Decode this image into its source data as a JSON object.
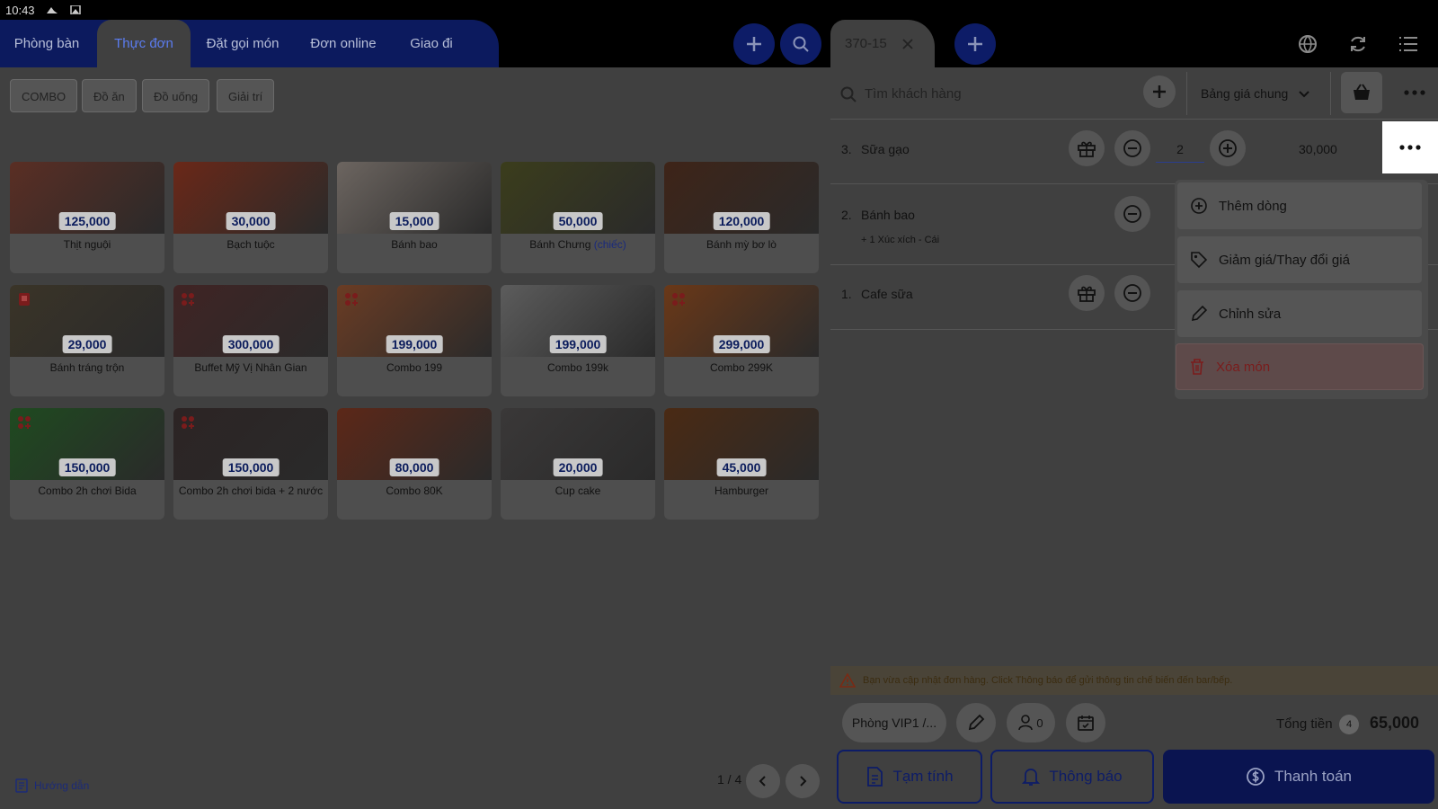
{
  "status": {
    "time": "10:43"
  },
  "nav": {
    "tabs": [
      {
        "label": "Phòng bàn"
      },
      {
        "label": "Thực đơn"
      },
      {
        "label": "Đặt gọi món"
      },
      {
        "label": "Đơn online"
      },
      {
        "label": "Giao đi"
      }
    ]
  },
  "filters": [
    "COMBO",
    "Đồ ăn",
    "Đồ uống",
    "Giải trí"
  ],
  "products": [
    {
      "price": "125,000",
      "name": "Thịt nguội",
      "color": "#5a2e24"
    },
    {
      "price": "30,000",
      "name": "Bạch tuộc",
      "color": "#6a2818"
    },
    {
      "price": "15,000",
      "name": "Bánh bao",
      "color": "#6c6560"
    },
    {
      "price": "50,000",
      "name": "Bánh Chưng",
      "name_hl": "(chiếc)",
      "color": "#3b3d1c"
    },
    {
      "price": "120,000",
      "name": "Bánh mỳ bơ lò",
      "color": "#3e2418"
    },
    {
      "price": "29,000",
      "name": "Bánh tráng trộn",
      "color": "#3a3428"
    },
    {
      "price": "300,000",
      "name": "Buffet Mỹ Vị Nhân Gian",
      "color": "#402424"
    },
    {
      "price": "199,000",
      "name": "Combo 199",
      "color": "#6a3c24"
    },
    {
      "price": "199,000",
      "name": "Combo 199k",
      "color": "#5c5c5c"
    },
    {
      "price": "299,000",
      "name": "Combo 299K",
      "color": "#6a3818"
    },
    {
      "price": "150,000",
      "name": "Combo 2h chơi Bida",
      "color": "#1f4a20"
    },
    {
      "price": "150,000",
      "name": "Combo 2h chơi bida + 2 nước",
      "color": "#2c2424"
    },
    {
      "price": "80,000",
      "name": "Combo 80K",
      "color": "#5c2818"
    },
    {
      "price": "20,000",
      "name": "Cup cake",
      "color": "#3a3838"
    },
    {
      "price": "45,000",
      "name": "Hamburger",
      "color": "#4a2a14"
    }
  ],
  "footer": {
    "guide": "Hướng dẫn",
    "page": "1 / 4"
  },
  "order": {
    "tab_label": "370-15",
    "search_placeholder": "Tìm khách hàng",
    "price_list": "Bảng giá chung",
    "lines": [
      {
        "idx": "3.",
        "name": "Sữa gạo",
        "qty": "2",
        "price": "30,000"
      },
      {
        "idx": "2.",
        "name": "Bánh bao",
        "sub": "+ 1 Xúc xích - Cái"
      },
      {
        "idx": "1.",
        "name": "Cafe sữa"
      }
    ],
    "menu": {
      "add_line": "Thêm dòng",
      "discount": "Giảm giá/Thay đổi giá",
      "edit": "Chỉnh sửa",
      "delete": "Xóa món"
    },
    "warning": "Bạn vừa cập nhật đơn hàng. Click Thông báo để gửi thông tin chế biến đến bar/bếp.",
    "room": "Phòng VIP1 /...",
    "guests": "0",
    "total_label": "Tổng tiền",
    "total_count": "4",
    "total_value": "65,000",
    "buttons": {
      "temp": "Tạm tính",
      "notify": "Thông báo",
      "pay": "Thanh toán"
    }
  }
}
